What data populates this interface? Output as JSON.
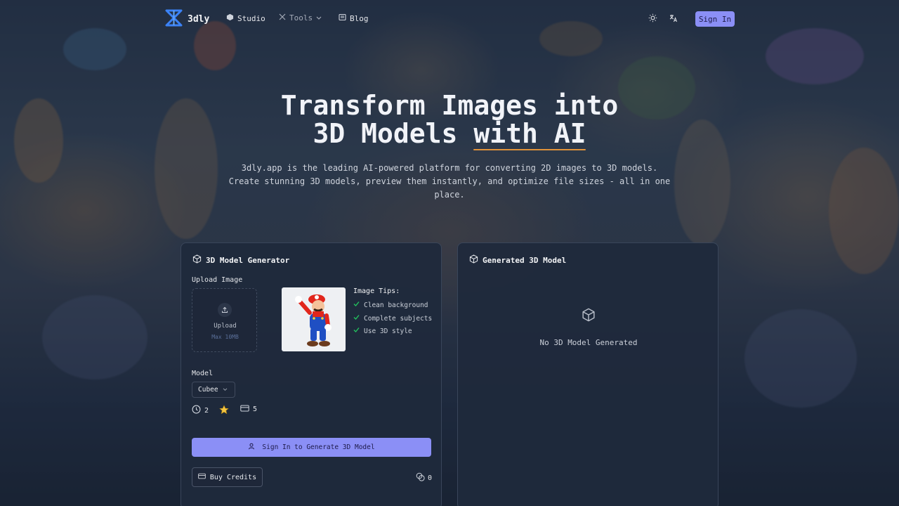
{
  "nav": {
    "brand": "3dly",
    "links": [
      {
        "label": "Studio",
        "icon": "cube-icon"
      },
      {
        "label": "Tools",
        "icon": "tools-icon"
      },
      {
        "label": "Blog",
        "icon": "blog-icon"
      }
    ],
    "sign_in": "Sign In"
  },
  "hero": {
    "title_line1": "Transform Images into",
    "title_line2_a": "3D Models ",
    "title_line2_b": "with AI",
    "subtitle": "3dly.app is the leading AI-powered platform for converting 2D images to 3D models. Create stunning 3D models, preview them instantly, and optimize file sizes - all in one place."
  },
  "generator": {
    "title": "3D Model Generator",
    "upload_label": "Upload Image",
    "upload_text": "Upload",
    "upload_max": "Max 10MB",
    "tips_title": "Image Tips:",
    "tips": [
      "Clean background",
      "Complete subjects",
      "Use 3D style"
    ],
    "model_label": "Model",
    "model_value": "Cubee",
    "stats": {
      "time": "2",
      "quality_icon": "star-icon",
      "credits_cost": "5"
    },
    "generate_button": "Sign In to Generate 3D Model",
    "buy_button": "Buy Credits",
    "credit_balance": "0"
  },
  "output": {
    "title": "Generated 3D Model",
    "empty_text": "No 3D Model Generated"
  },
  "colors": {
    "accent": "#8b8ff6",
    "underline": "#e0933a",
    "card_bg": "#1f293b",
    "check": "#22c55e"
  }
}
